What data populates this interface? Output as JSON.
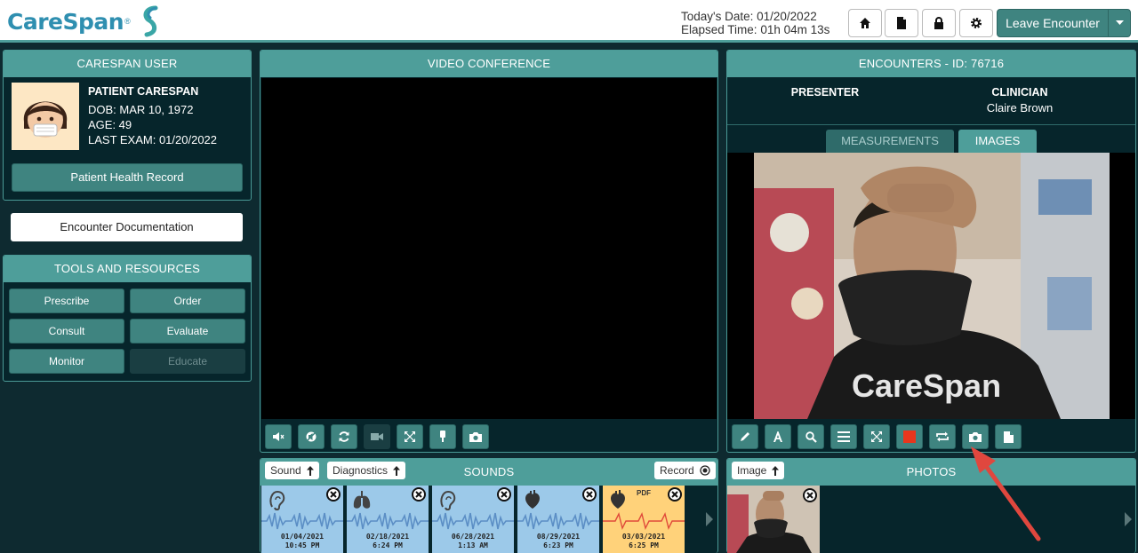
{
  "header": {
    "logo_text": "CareSpan",
    "logo_tm": "®",
    "date_label": "Today's Date:",
    "date_value": "01/20/2022",
    "elapsed_label": "Elapsed Time:",
    "elapsed_value": "01h 04m 13s",
    "leave_label": "Leave Encounter",
    "icons": [
      "home-icon",
      "document-icon",
      "lock-icon",
      "gear-icon"
    ]
  },
  "user_panel": {
    "title": "CARESPAN USER",
    "name": "PATIENT CARESPAN",
    "dob": "DOB: MAR 10, 1972",
    "age": "AGE: 49",
    "last_exam": "LAST EXAM: 01/20/2022",
    "phr_label": "Patient Health Record"
  },
  "encounter_doc_label": "Encounter Documentation",
  "tools": {
    "title": "TOOLS AND RESOURCES",
    "items": [
      {
        "label": "Prescribe",
        "enabled": true
      },
      {
        "label": "Order",
        "enabled": true
      },
      {
        "label": "Consult",
        "enabled": true
      },
      {
        "label": "Evaluate",
        "enabled": true
      },
      {
        "label": "Monitor",
        "enabled": true
      },
      {
        "label": "Educate",
        "enabled": false
      }
    ]
  },
  "video": {
    "title": "VIDEO CONFERENCE",
    "controls": [
      "mute-icon",
      "speaker-off-icon",
      "refresh-icon",
      "camera-icon",
      "fullscreen-icon",
      "flashlight-icon",
      "snapshot-icon"
    ]
  },
  "encounter": {
    "title": "ENCOUNTERS - ID: 76716",
    "presenter_label": "PRESENTER",
    "presenter_name": "",
    "clinician_label": "CLINICIAN",
    "clinician_name": "Claire Brown",
    "tabs": [
      {
        "label": "MEASUREMENTS",
        "active": false
      },
      {
        "label": "IMAGES",
        "active": true
      }
    ],
    "image_text": "CareSpan",
    "controls": [
      "pencil-icon",
      "text-icon",
      "zoom-icon",
      "list-icon",
      "fullscreen-icon",
      "record-icon",
      "rotate-icon",
      "snapshot-icon",
      "document-icon"
    ]
  },
  "sounds": {
    "title": "SOUNDS",
    "sound_select": "Sound",
    "diag_select": "Diagnostics",
    "record_label": "Record",
    "items": [
      {
        "icon": "ear-icon",
        "date": "01/04/2021",
        "time": "10:45 PM",
        "type": "sound"
      },
      {
        "icon": "lungs-icon",
        "date": "02/18/2021",
        "time": "6:24 PM",
        "type": "sound"
      },
      {
        "icon": "ear-icon",
        "date": "06/28/2021",
        "time": "1:13 AM",
        "type": "sound"
      },
      {
        "icon": "heart-icon",
        "date": "08/29/2021",
        "time": "6:23 PM",
        "type": "sound"
      },
      {
        "icon": "heart-icon",
        "date": "03/03/2021",
        "time": "6:25 PM",
        "type": "pdf",
        "tag": "PDF"
      }
    ]
  },
  "photos": {
    "title": "PHOTOS",
    "image_select": "Image"
  },
  "colors": {
    "teal_header": "#4e9e9a",
    "teal_button": "#3f8480",
    "background": "#0e2a30",
    "record_red": "#e8361d",
    "annotation_arrow": "#e0473e"
  }
}
